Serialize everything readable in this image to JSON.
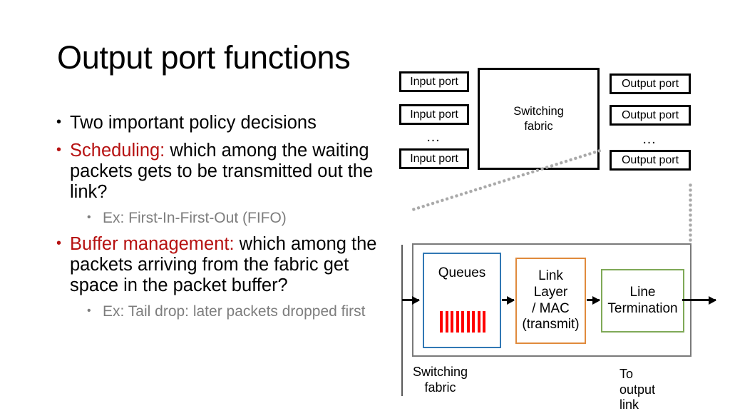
{
  "slide": {
    "title": "Output port functions"
  },
  "bullets": [
    {
      "level": 1,
      "lead": "",
      "text": "Two important policy decisions",
      "color": "#000000"
    },
    {
      "level": 1,
      "lead": "Scheduling:",
      "text": " which among the waiting packets gets to be transmitted out the link?",
      "color": "#000000"
    },
    {
      "level": 2,
      "lead": "",
      "text": "Ex: First-In-First-Out (FIFO)",
      "color": "#7D7D7D"
    },
    {
      "level": 1,
      "lead": "Buffer management:",
      "text": " which among the packets arriving from the fabric get space in the packet buffer?",
      "color": "#000000"
    },
    {
      "level": 2,
      "lead": "",
      "text": "Ex: Tail drop: later packets dropped first",
      "color": "#7D7D7D"
    }
  ],
  "router_diagram": {
    "input_ports": [
      "Input port",
      "Input port",
      "Input port"
    ],
    "input_ellipsis": "…",
    "switching_fabric_line1": "Switching",
    "switching_fabric_line2": "fabric",
    "output_ports": [
      "Output port",
      "Output port",
      "Output port"
    ],
    "output_ellipsis": "…"
  },
  "output_port_detail": {
    "queues_label": "Queues",
    "queue_packet_count": 9,
    "queue_packet_color": "#FF0000",
    "link_layer_line1": "Link",
    "link_layer_line2": "Layer",
    "link_layer_line3": "/ MAC",
    "link_layer_line4": "(transmit)",
    "line_termination_line1": "Line",
    "line_termination_line2": "Termination",
    "left_caption_line1": "Switching",
    "left_caption_line2": "fabric",
    "right_caption": "To output link"
  },
  "colors": {
    "accent_red": "#B61111",
    "queue_border": "#3178B4",
    "link_layer_border": "#E08A3C",
    "line_termination_border": "#7FA957",
    "muted_text": "#7D7D7D",
    "dotted_leader": "#A9A9A9"
  }
}
